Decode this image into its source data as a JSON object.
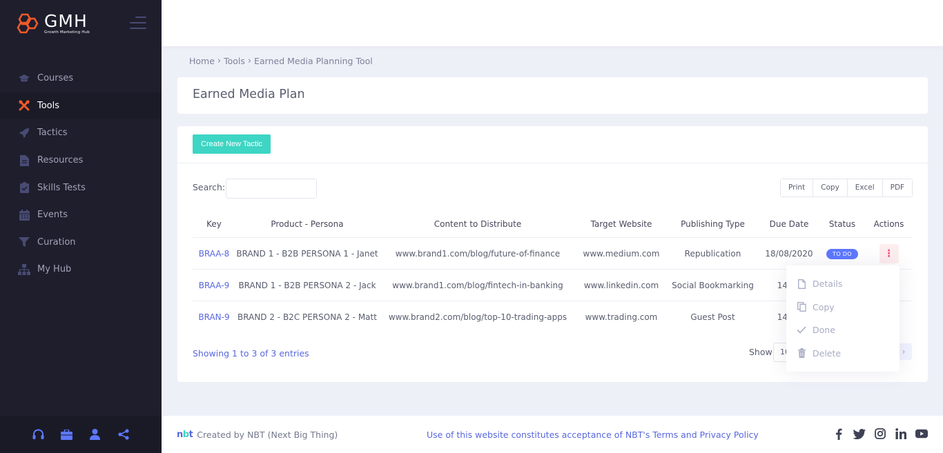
{
  "brand": {
    "title": "GMH",
    "subtitle": "Growth Marketing Hub"
  },
  "sidebar": {
    "items": [
      {
        "label": "Courses",
        "icon": "graduation-cap-icon",
        "active": false
      },
      {
        "label": "Tools",
        "icon": "tools-icon",
        "active": true
      },
      {
        "label": "Tactics",
        "icon": "rocket-icon",
        "active": false
      },
      {
        "label": "Resources",
        "icon": "document-icon",
        "active": false
      },
      {
        "label": "Skills Tests",
        "icon": "clipboard-check-icon",
        "active": false
      },
      {
        "label": "Events",
        "icon": "calendar-icon",
        "active": false
      },
      {
        "label": "Curation",
        "icon": "filter-icon",
        "active": false
      },
      {
        "label": "My Hub",
        "icon": "sitemap-icon",
        "active": false
      }
    ],
    "footer_icons": [
      "headset-icon",
      "briefcase-icon",
      "user-icon",
      "share-icon"
    ]
  },
  "breadcrumb": {
    "home": "Home",
    "tools": "Tools",
    "current": "Earned Media Planning Tool"
  },
  "page": {
    "title": "Earned Media Plan"
  },
  "toolbar": {
    "create_label": "Create New Tactic",
    "search_label": "Search:",
    "search_value": "",
    "export": {
      "print": "Print",
      "copy": "Copy",
      "excel": "Excel",
      "pdf": "PDF"
    }
  },
  "table": {
    "headers": {
      "key": "Key",
      "product": "Product - Persona",
      "content": "Content to Distribute",
      "site": "Target Website",
      "publishing": "Publishing Type",
      "due": "Due Date",
      "status": "Status",
      "actions": "Actions"
    },
    "rows": [
      {
        "key": "BRAA-8",
        "product": "BRAND 1 - B2B PERSONA 1 - Janet",
        "content": "www.brand1.com/blog/future-of-finance",
        "site": "www.medium.com",
        "publishing": "Republication",
        "due": "18/08/2020",
        "status": "TO DO"
      },
      {
        "key": "BRAA-9",
        "product": "BRAND 1 - B2B PERSONA 2 - Jack",
        "content": "www.brand1.com/blog/fintech-in-banking",
        "site": "www.linkedin.com",
        "publishing": "Social Bookmarking",
        "due": "14/09",
        "status": ""
      },
      {
        "key": "BRAN-9",
        "product": "BRAND 2 - B2C PERSONA 2 - Matt",
        "content": "www.brand2.com/blog/top-10-trading-apps",
        "site": "www.trading.com",
        "publishing": "Guest Post",
        "due": "14/10",
        "status": ""
      }
    ]
  },
  "pagination": {
    "info": "Showing 1 to 3 of 3 entries",
    "show_label": "Show",
    "page_size": "10",
    "next_symbol": "›"
  },
  "actions_menu": {
    "details": "Details",
    "copy": "Copy",
    "done": "Done",
    "delete": "Delete"
  },
  "footer": {
    "created_by": "Created by",
    "company": "NBT (Next Big Thing)",
    "notice": "Use of this website constitutes acceptance of NBT's",
    "terms": "Terms",
    "and": "and",
    "privacy": "Privacy Policy",
    "socials": [
      "facebook-icon",
      "twitter-icon",
      "instagram-icon",
      "linkedin-icon",
      "youtube-icon"
    ]
  },
  "colors": {
    "accent": "#5867dd",
    "teal": "#3dd5c4",
    "orange": "#f15a29",
    "sidebar": "#1e1e2d",
    "badge": "#5d78ff",
    "danger": "#fd397a"
  }
}
